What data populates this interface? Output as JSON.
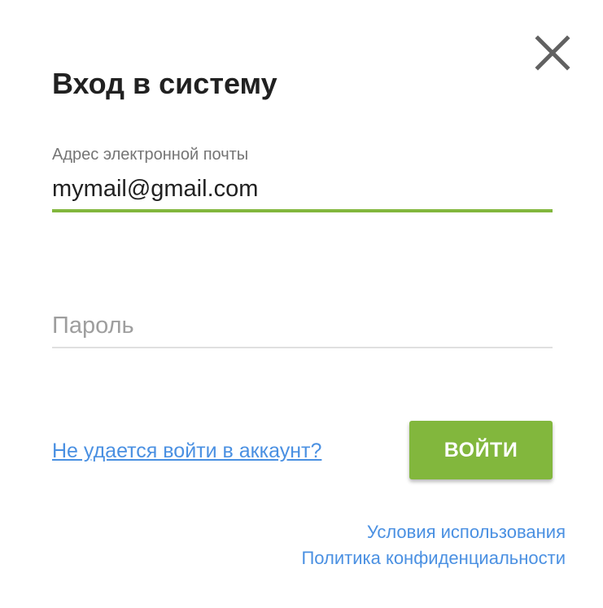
{
  "dialog": {
    "title": "Вход в систему",
    "close_icon": "close-icon"
  },
  "email": {
    "label": "Адрес электронной почты",
    "value": "mymail@gmail.com",
    "underline_color": "#82b73d"
  },
  "password": {
    "placeholder": "Пароль",
    "value": ""
  },
  "actions": {
    "forgot_label": "Не удается войти в аккаунт?",
    "login_label": "ВОЙТИ",
    "accent_color": "#82b73d",
    "link_color": "#4a90e2"
  },
  "footer": {
    "terms_label": "Условия использования",
    "privacy_label": "Политика конфиденциальности"
  }
}
